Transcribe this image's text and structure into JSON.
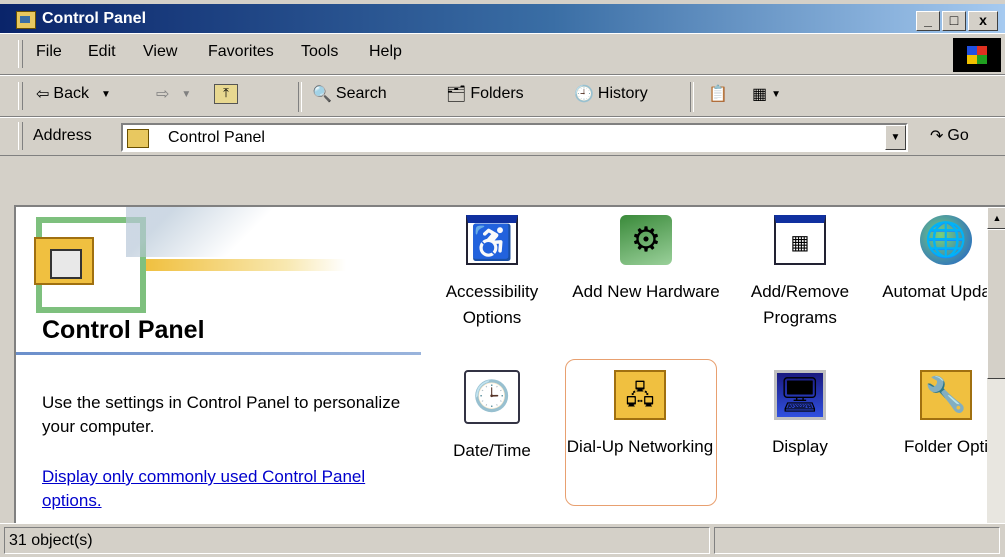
{
  "window": {
    "title": "Control Panel",
    "buttons": {
      "minimize": "_",
      "maximize": "□",
      "close": "x"
    }
  },
  "menu": [
    "File",
    "Edit",
    "View",
    "Favorites",
    "Tools",
    "Help"
  ],
  "toolbar": {
    "back": "Back",
    "search": "Search",
    "folders": "Folders",
    "history": "History"
  },
  "address": {
    "label": "Address",
    "value": "Control Panel",
    "go": "Go"
  },
  "left_pane": {
    "title": "Control Panel",
    "description": "Use the settings in Control Panel to personalize your computer.",
    "link": "Display only commonly used Control Panel options."
  },
  "items": [
    {
      "label": "Accessibility Options",
      "icon": "accessibility-icon"
    },
    {
      "label": "Add New Hardware",
      "icon": "hardware-icon"
    },
    {
      "label": "Add/Remove Programs",
      "icon": "add-remove-programs-icon"
    },
    {
      "label": "Automat Update:",
      "icon": "automatic-updates-icon"
    },
    {
      "label": "Date/Time",
      "icon": "date-time-icon"
    },
    {
      "label": "Dial-Up Networking",
      "icon": "dial-up-networking-icon"
    },
    {
      "label": "Display",
      "icon": "display-icon"
    },
    {
      "label": "Folder Opti",
      "icon": "folder-options-icon"
    }
  ],
  "status": {
    "objects": "31 object(s)"
  }
}
